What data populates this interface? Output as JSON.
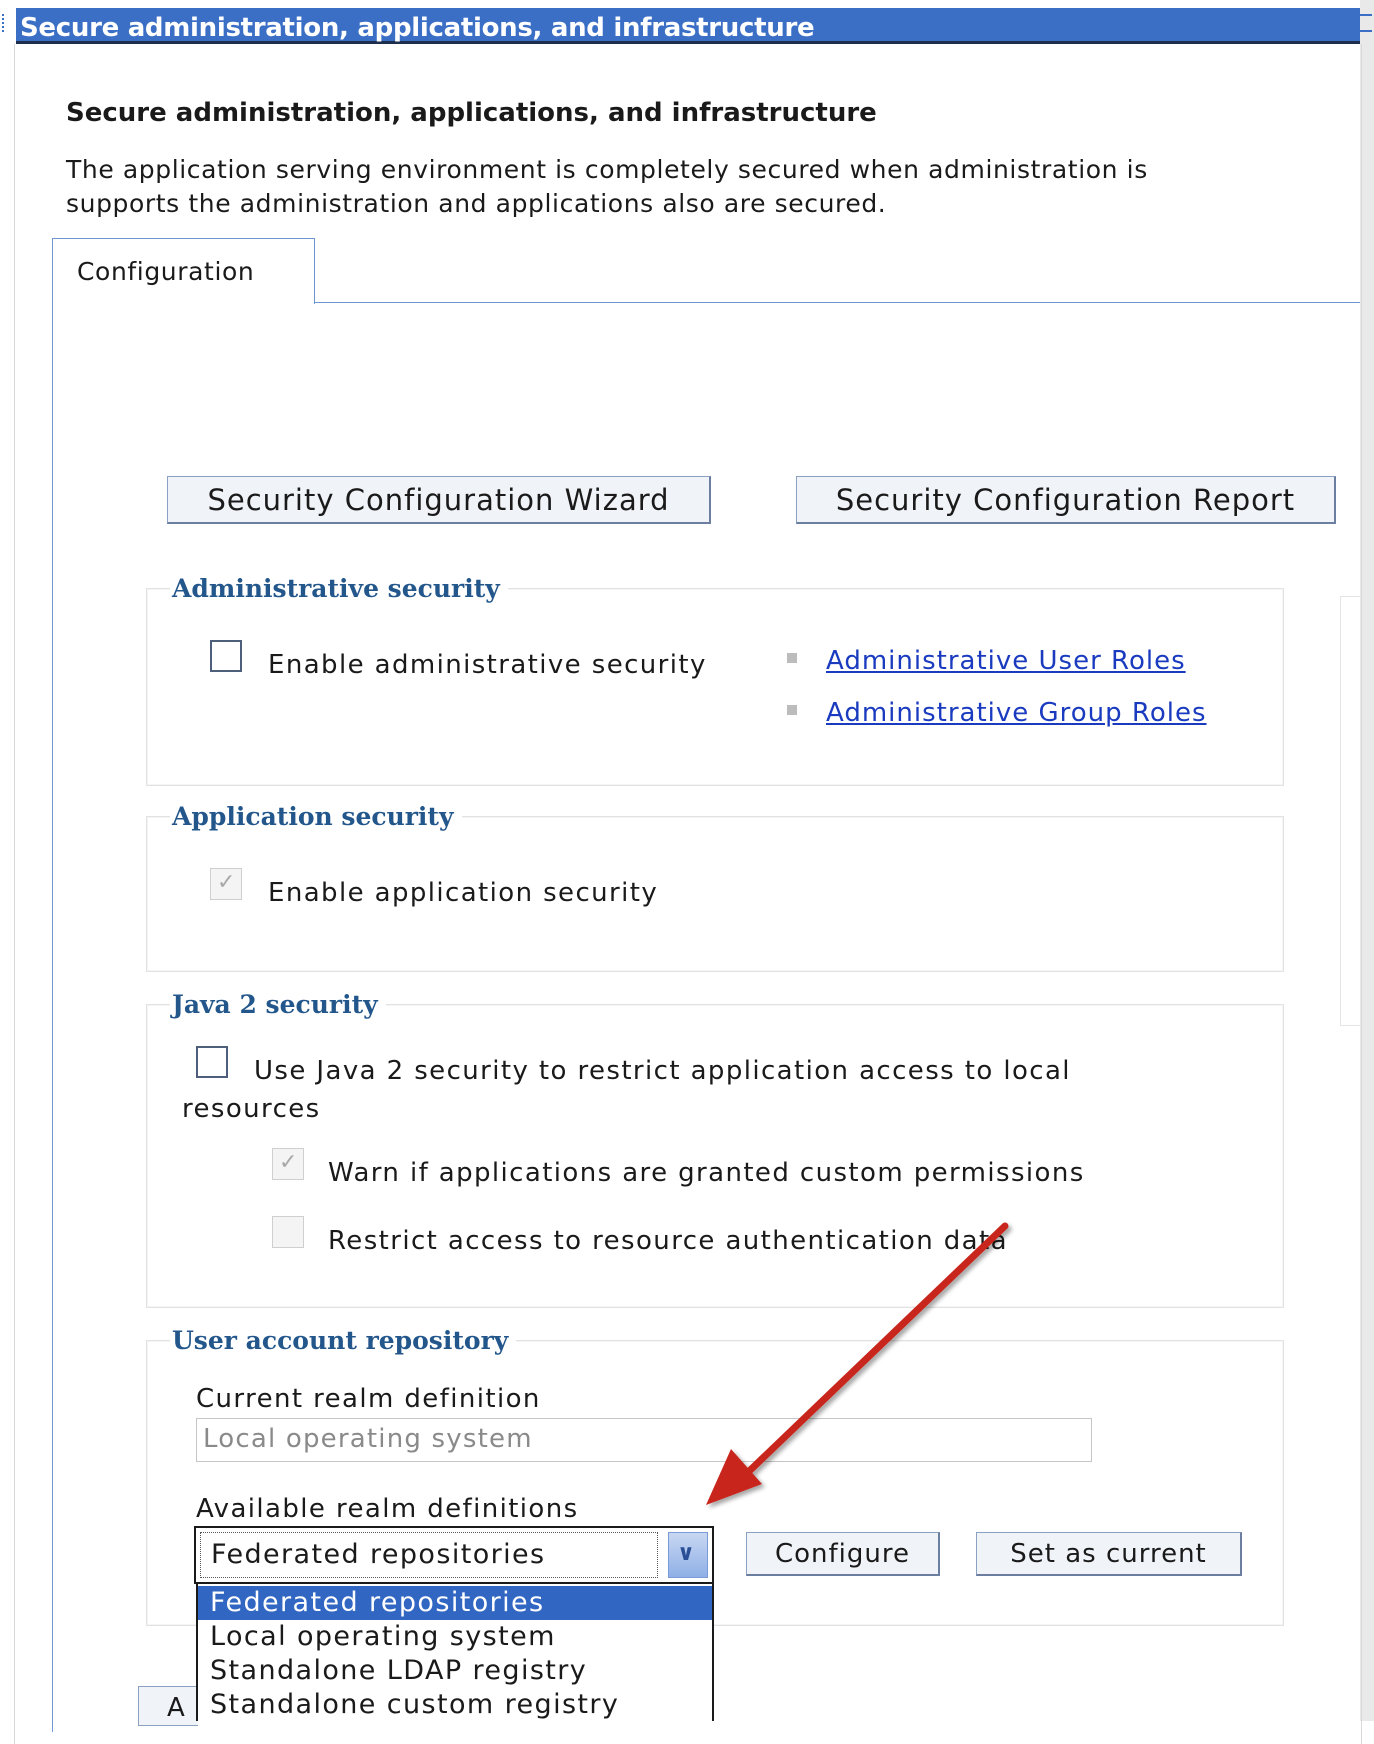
{
  "window": {
    "title": "Secure administration, applications, and infrastructure"
  },
  "page": {
    "heading": "Secure administration, applications, and infrastructure",
    "description_line1": "The application serving environment is completely secured when administration is",
    "description_line2": "supports the administration and applications also are secured."
  },
  "tabs": [
    {
      "label": "Configuration",
      "active": true
    }
  ],
  "toolbar": {
    "wizard_label": "Security Configuration Wizard",
    "report_label": "Security Configuration Report"
  },
  "admin_security": {
    "legend": "Administrative security",
    "enable_label": "Enable administrative security",
    "enable_checked": false,
    "links": [
      "Administrative User Roles",
      "Administrative Group Roles"
    ]
  },
  "app_security": {
    "legend": "Application security",
    "enable_label": "Enable application security",
    "enable_checked": true,
    "enable_disabled": true
  },
  "java2_security": {
    "legend": "Java 2 security",
    "use_label_line1": "Use Java 2 security to restrict application access to local",
    "use_label_line2": "resources",
    "use_checked": false,
    "warn_label": "Warn if applications are granted custom permissions",
    "warn_checked": true,
    "restrict_label": "Restrict access to resource authentication data",
    "restrict_checked": false
  },
  "user_repository": {
    "legend": "User account repository",
    "current_label": "Current realm definition",
    "current_value": "Local operating system",
    "available_label": "Available realm definitions",
    "selected": "Federated repositories",
    "options": [
      "Federated repositories",
      "Local operating system",
      "Standalone LDAP registry",
      "Standalone custom registry"
    ],
    "configure_label": "Configure",
    "set_current_label": "Set as current"
  },
  "apply_stub_text": "A",
  "colors": {
    "titlebar": "#3b6fc6",
    "legend": "#23578c",
    "link": "#1a3bbf",
    "selected_option": "#3166c2",
    "annotation_arrow": "#c8281e"
  },
  "icons": {
    "dropdown": "chevron-down-icon",
    "bullet": "square-bullet-icon",
    "annotation": "arrow-annotation-icon"
  }
}
